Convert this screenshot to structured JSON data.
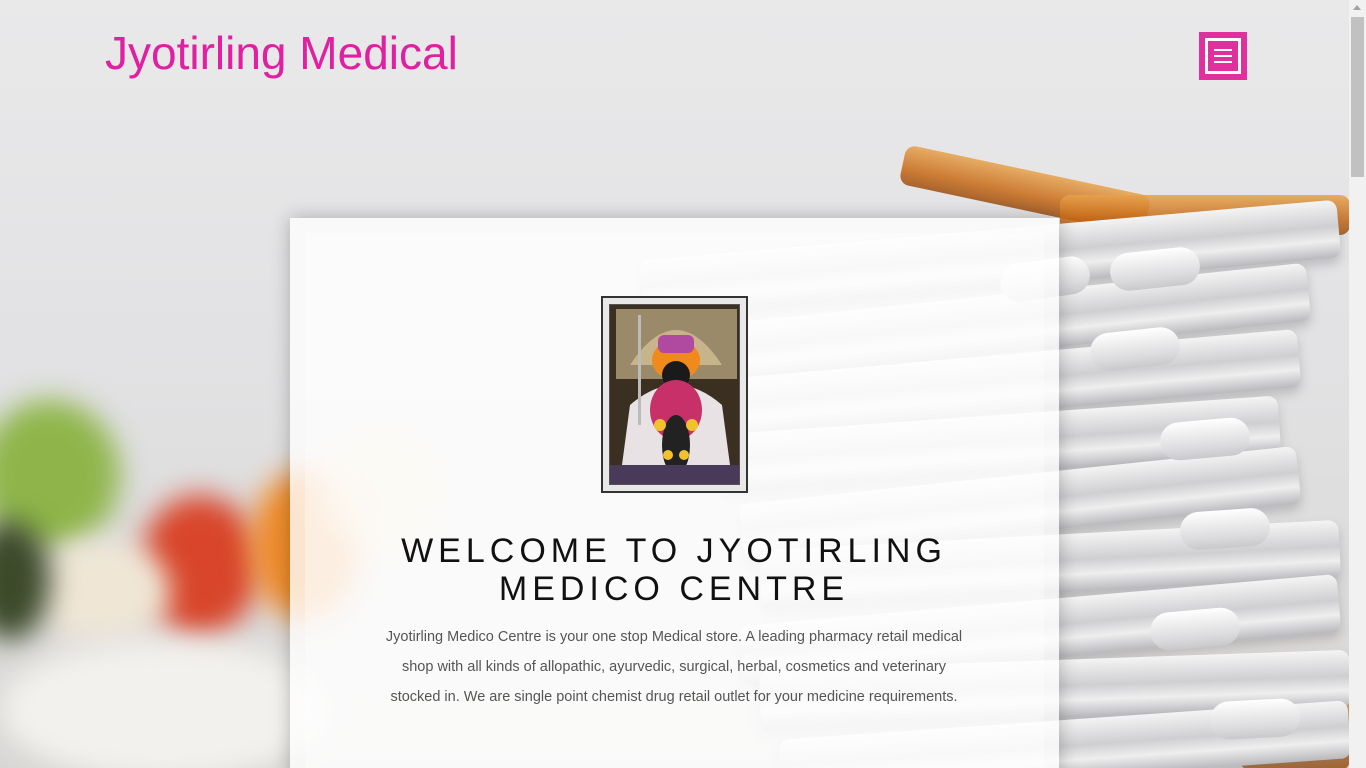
{
  "header": {
    "site_title": "Jyotirling Medical",
    "menu_icon": "hamburger-icon",
    "brand_color": "#e0309e"
  },
  "hero": {
    "image_alt_icon": "deity-photo",
    "heading": "WELCOME TO JYOTIRLING MEDICO CENTRE",
    "description": "Jyotirling Medico Centre is your one stop Medical store. A leading pharmacy retail medical shop with all kinds of allopathic, ayurvedic, surgical, herbal, cosmetics and veterinary stocked in. We are single point chemist drug retail outlet for your medicine requirements."
  }
}
